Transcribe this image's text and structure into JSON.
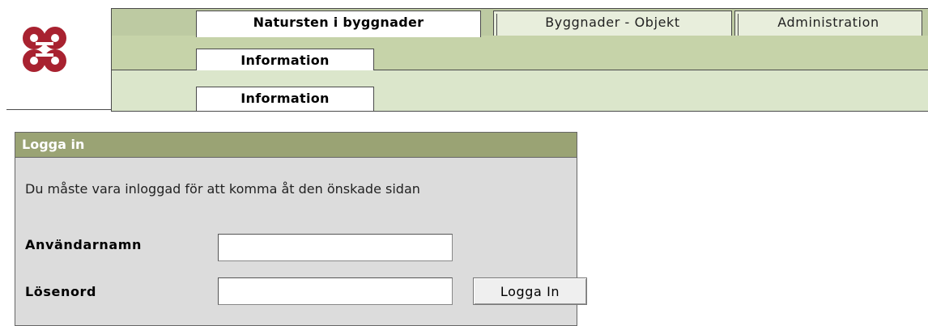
{
  "logo": {
    "icon": "command-knot-icon",
    "color": "#a82230"
  },
  "tabs_row1": [
    {
      "label": "Natursten i byggnader",
      "active": true
    },
    {
      "label": "Byggnader - Objekt",
      "active": false
    },
    {
      "label": "Administration",
      "active": false
    }
  ],
  "tabs_row2": [
    {
      "label": "Information",
      "active": true
    }
  ],
  "tabs_row3": [
    {
      "label": "Information",
      "active": true
    }
  ],
  "login": {
    "header": "Logga in",
    "message": "Du måste vara inloggad för att komma åt den önskade sidan",
    "username_label": "Användarnamn",
    "username_value": "",
    "password_label": "Lösenord",
    "password_value": "",
    "submit_label": "Logga In"
  },
  "colors": {
    "band_top": "#bdcaa2",
    "band_mid": "#c6d3a9",
    "band_bottom": "#dbe6cb",
    "panel_header": "#9aa374",
    "panel_body": "#dcdcdc"
  }
}
